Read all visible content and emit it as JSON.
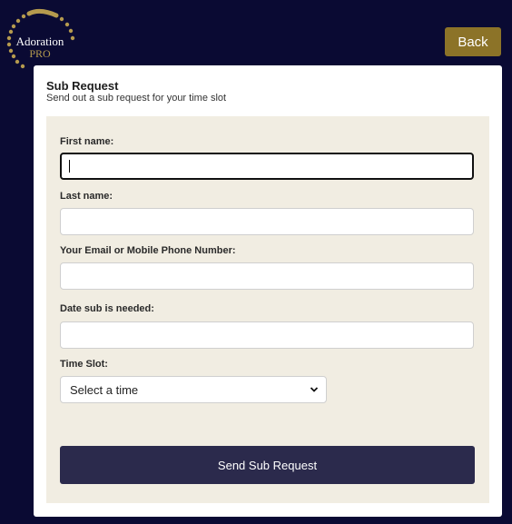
{
  "brand": {
    "name": "Adoration",
    "sub": "PRO",
    "colors": {
      "gold": "#b59a4e",
      "navy": "#0a0a33"
    }
  },
  "header": {
    "back_label": "Back"
  },
  "card": {
    "title": "Sub Request",
    "subtitle": "Send out a sub request for your time slot"
  },
  "form": {
    "first_name": {
      "label": "First name:",
      "value": ""
    },
    "last_name": {
      "label": "Last name:",
      "value": ""
    },
    "contact": {
      "label": "Your Email or Mobile Phone Number:",
      "value": ""
    },
    "date": {
      "label": "Date sub is needed:",
      "value": ""
    },
    "time_slot": {
      "label": "Time Slot:",
      "selected": "Select a time"
    },
    "submit_label": "Send Sub Request"
  },
  "icons": {
    "dropdown": "chevron-down-icon"
  },
  "colors": {
    "button": "#2b2a4c",
    "back_button": "#8c7328",
    "panel": "#f1ede2"
  }
}
